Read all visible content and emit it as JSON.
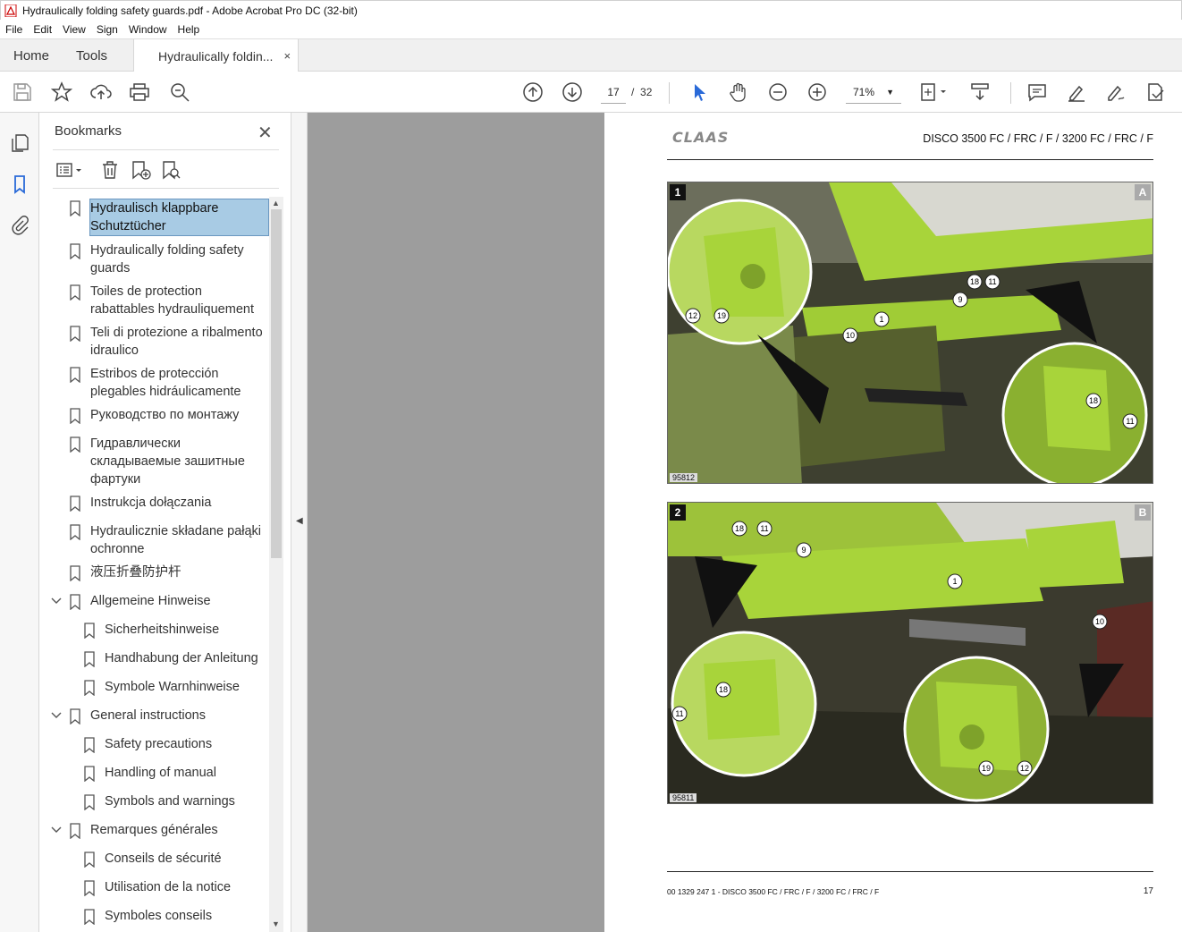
{
  "window": {
    "title": "Hydraulically folding safety guards.pdf - Adobe Acrobat Pro DC (32-bit)"
  },
  "menu": [
    "File",
    "Edit",
    "View",
    "Sign",
    "Window",
    "Help"
  ],
  "tabs": {
    "home": "Home",
    "tools": "Tools",
    "document": "Hydraulically foldin...",
    "close": "×"
  },
  "toolbar": {
    "current_page": "17",
    "page_separator": "/",
    "total_pages": "32",
    "zoom": "71%"
  },
  "bookmarks": {
    "title": "Bookmarks",
    "close": "✕",
    "items": [
      {
        "label": "Hydraulisch klappbare Schutztücher",
        "level": 0,
        "selected": true
      },
      {
        "label": "Hydraulically folding safety guards",
        "level": 0
      },
      {
        "label": "Toiles de protection rabattables hydrauliquement",
        "level": 0
      },
      {
        "label": "Teli di protezione a ribalmento idraulico",
        "level": 0
      },
      {
        "label": "Estribos de protección plegables hidráulicamente",
        "level": 0
      },
      {
        "label": "Руководство по монтажу",
        "level": 0
      },
      {
        "label": "Гидравлически складываемые зашитные фартуки",
        "level": 0
      },
      {
        "label": "Instrukcja dołączania",
        "level": 0
      },
      {
        "label": "Hydraulicznie składane pałąki ochronne",
        "level": 0
      },
      {
        "label": "液压折叠防护杆",
        "level": 0
      },
      {
        "label": "Allgemeine Hinweise",
        "level": 0,
        "expanded": true
      },
      {
        "label": "Sicherheitshinweise",
        "level": 1
      },
      {
        "label": "Handhabung der Anleitung",
        "level": 1
      },
      {
        "label": "Symbole Warnhinweise",
        "level": 1
      },
      {
        "label": "General instructions",
        "level": 0,
        "expanded": true
      },
      {
        "label": "Safety precautions",
        "level": 1
      },
      {
        "label": "Handling of manual",
        "level": 1
      },
      {
        "label": "Symbols and warnings",
        "level": 1
      },
      {
        "label": "Remarques générales",
        "level": 0,
        "expanded": true
      },
      {
        "label": "Conseils de sécurité",
        "level": 1
      },
      {
        "label": "Utilisation de la notice",
        "level": 1
      },
      {
        "label": "Symboles conseils",
        "level": 1
      }
    ]
  },
  "page": {
    "logo": "CLAAS",
    "model": "DISCO 3500 FC / FRC / F / 3200 FC / FRC / F",
    "figure1": {
      "number": "1",
      "letter": "A",
      "code": "95812",
      "callouts": [
        "18",
        "11",
        "9",
        "1",
        "10",
        "12",
        "19",
        "18",
        "11"
      ]
    },
    "figure2": {
      "number": "2",
      "letter": "B",
      "code": "95811",
      "callouts": [
        "18",
        "11",
        "9",
        "1",
        "10",
        "18",
        "11",
        "19",
        "12"
      ]
    },
    "footer_left": "00 1329 247 1 - DISCO 3500 FC / FRC / F / 3200 FC / FRC / F",
    "footer_right": "17"
  },
  "colors": {
    "selection": "#a8cbe4",
    "machine_green": "#a8d43a",
    "doc_gray": "#9d9d9d"
  }
}
